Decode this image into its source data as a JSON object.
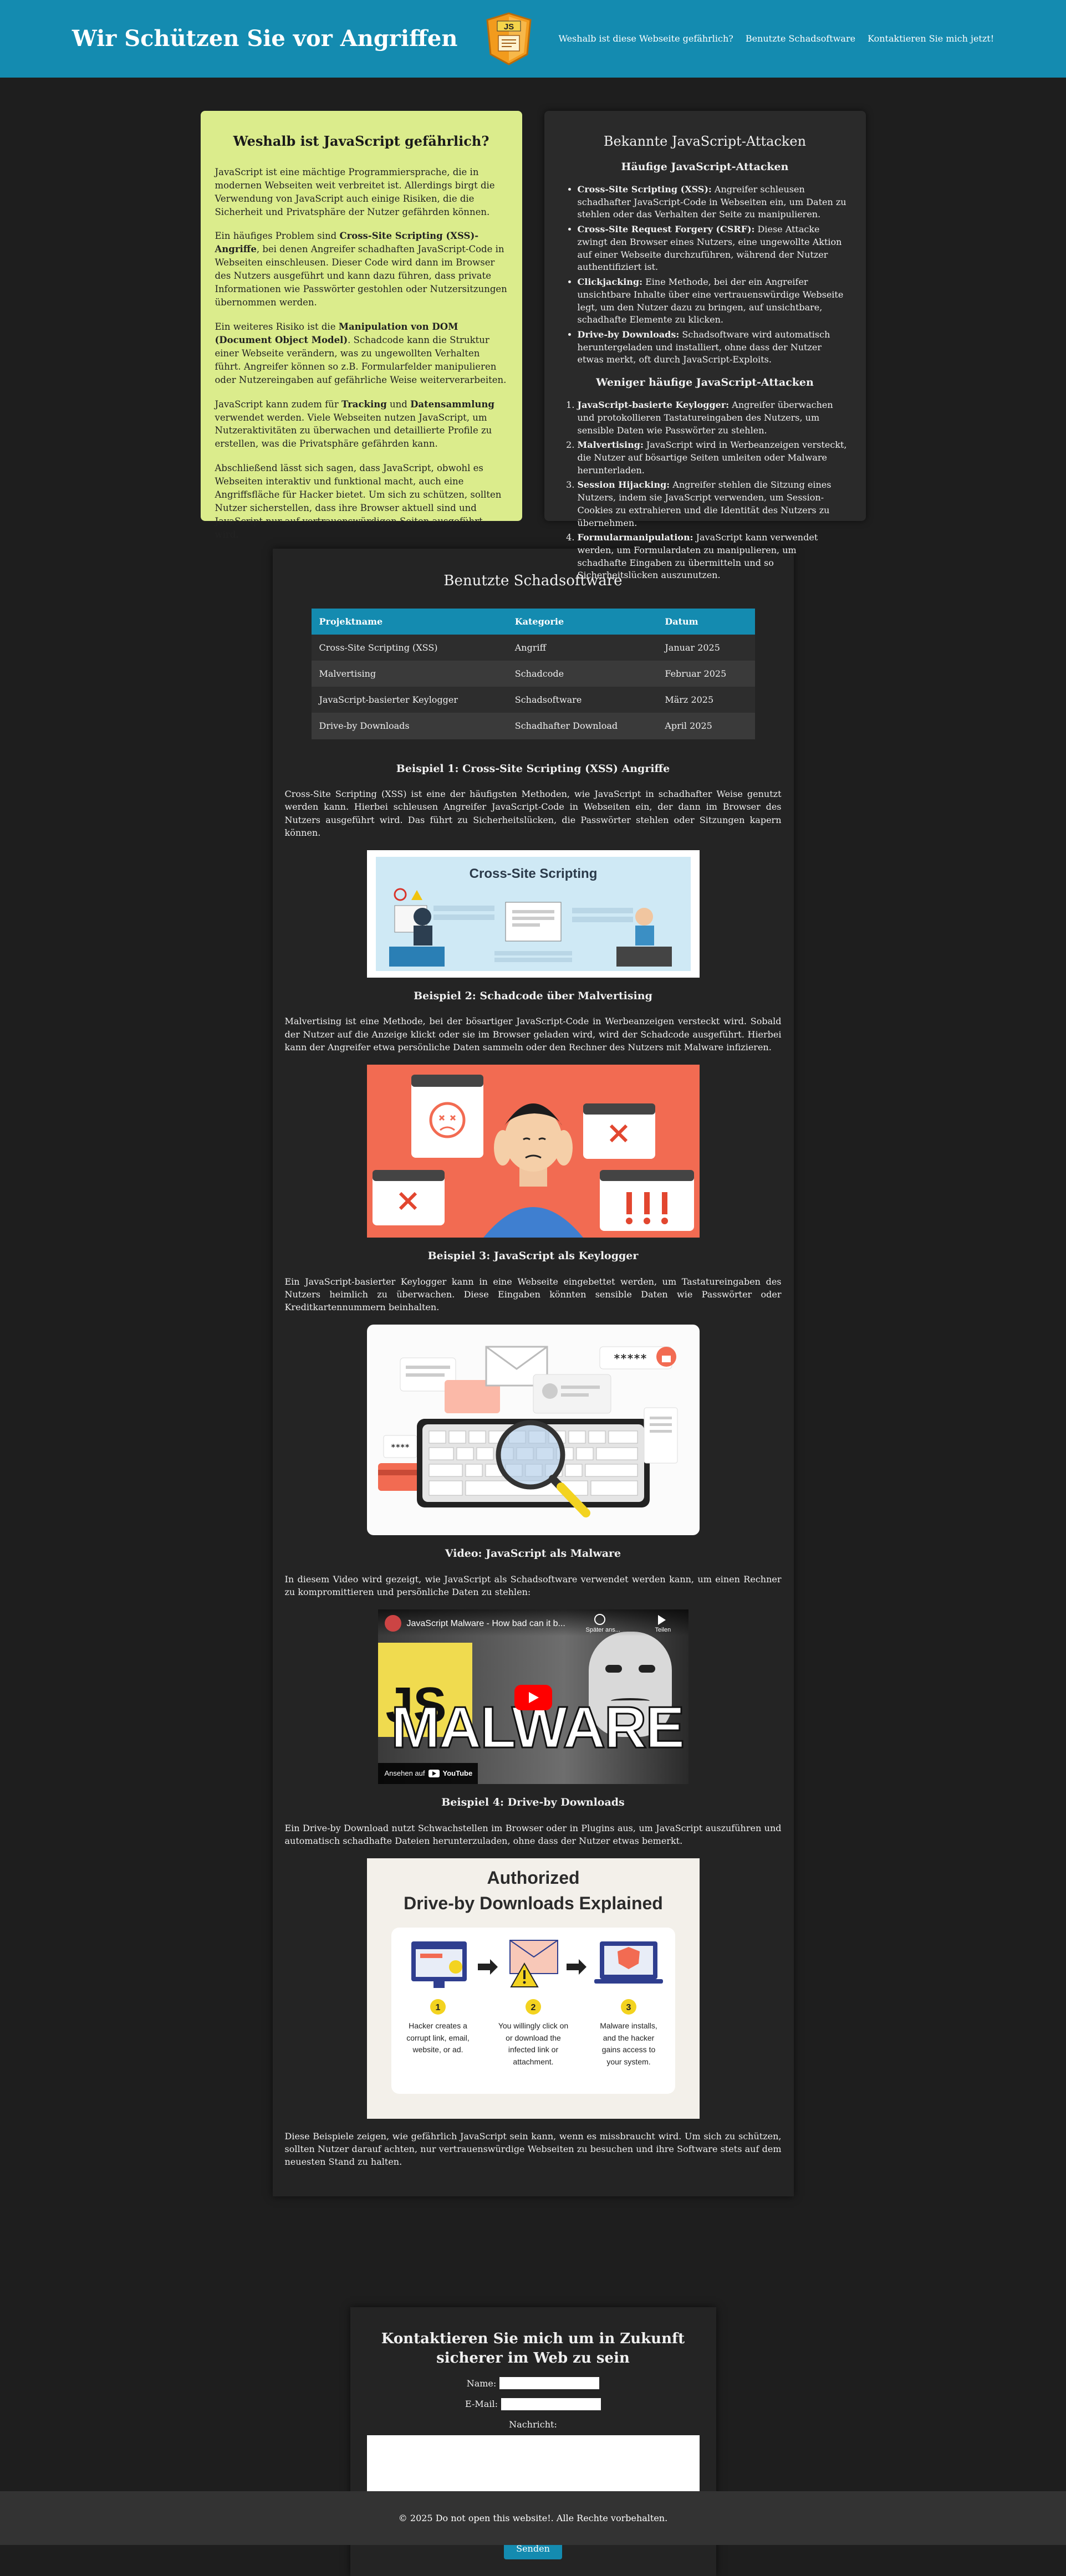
{
  "header": {
    "title": "Wir Schützen Sie vor Angriffen",
    "logo_text": "JS",
    "nav": [
      "Weshalb ist diese Webseite gefährlich?",
      "Benutzte Schadsoftware",
      "Kontaktieren Sie mich jetzt!"
    ]
  },
  "why": {
    "heading": "Weshalb ist JavaScript gefährlich?",
    "p1": "JavaScript ist eine mächtige Programmiersprache, die in modernen Webseiten weit verbreitet ist. Allerdings birgt die Verwendung von JavaScript auch einige Risiken, die die Sicherheit und Privatsphäre der Nutzer gefährden können.",
    "p2_a": "Ein häufiges Problem sind ",
    "p2_b": "Cross-Site Scripting (XSS)-Angriffe",
    "p2_c": ", bei denen Angreifer schadhaften JavaScript-Code in Webseiten einschleusen. Dieser Code wird dann im Browser des Nutzers ausgeführt und kann dazu führen, dass private Informationen wie Passwörter gestohlen oder Nutzersitzungen übernommen werden.",
    "p3_a": "Ein weiteres Risiko ist die ",
    "p3_b": "Manipulation von DOM (Document Object Model)",
    "p3_c": ". Schadcode kann die Struktur einer Webseite verändern, was zu ungewollten Verhalten führt. Angreifer können so z.B. Formularfelder manipulieren oder Nutzereingaben auf gefährliche Weise weiterverarbeiten.",
    "p4_a": "JavaScript kann zudem für ",
    "p4_b": "Tracking",
    "p4_c": " und ",
    "p4_d": "Datensammlung",
    "p4_e": " verwendet werden. Viele Webseiten nutzen JavaScript, um Nutzeraktivitäten zu überwachen und detaillierte Profile zu erstellen, was die Privatsphäre gefährden kann.",
    "p5": "Abschließend lässt sich sagen, dass JavaScript, obwohl es Webseiten interaktiv und funktional macht, auch eine Angriffsfläche für Hacker bietet. Um sich zu schützen, sollten Nutzer sicherstellen, dass ihre Browser aktuell sind und JavaScript nur auf vertrauenswürdigen Seiten ausgeführt wird."
  },
  "attacks": {
    "heading": "Bekannte JavaScript-Attacken",
    "common_heading": "Häufige JavaScript-Attacken",
    "common": [
      {
        "term": "Cross-Site Scripting (XSS):",
        "text": " Angreifer schleusen schadhafter JavaScript-Code in Webseiten ein, um Daten zu stehlen oder das Verhalten der Seite zu manipulieren."
      },
      {
        "term": "Cross-Site Request Forgery (CSRF):",
        "text": " Diese Attacke zwingt den Browser eines Nutzers, eine ungewollte Aktion auf einer Webseite durchzuführen, während der Nutzer authentifiziert ist."
      },
      {
        "term": "Clickjacking:",
        "text": " Eine Methode, bei der ein Angreifer unsichtbare Inhalte über eine vertrauenswürdige Webseite legt, um den Nutzer dazu zu bringen, auf unsichtbare, schadhafte Elemente zu klicken."
      },
      {
        "term": "Drive-by Downloads:",
        "text": " Schadsoftware wird automatisch heruntergeladen und installiert, ohne dass der Nutzer etwas merkt, oft durch JavaScript-Exploits."
      }
    ],
    "rare_heading": "Weniger häufige JavaScript-Attacken",
    "rare": [
      {
        "term": "JavaScript-basierte Keylogger:",
        "text": " Angreifer überwachen und protokollieren Tastatureingaben des Nutzers, um sensible Daten wie Passwörter zu stehlen."
      },
      {
        "term": "Malvertising:",
        "text": " JavaScript wird in Werbeanzeigen versteckt, die Nutzer auf bösartige Seiten umleiten oder Malware herunterladen."
      },
      {
        "term": "Session Hijacking:",
        "text": " Angreifer stehlen die Sitzung eines Nutzers, indem sie JavaScript verwenden, um Session-Cookies zu extrahieren und die Identität des Nutzers zu übernehmen."
      },
      {
        "term": "Formularmanipulation:",
        "text": " JavaScript kann verwendet werden, um Formulardaten zu manipulieren, um schadhafte Eingaben zu übermitteln und so Sicherheitslücken auszunutzen."
      }
    ]
  },
  "malware": {
    "heading": "Benutzte Schadsoftware",
    "columns": [
      "Projektname",
      "Kategorie",
      "Datum"
    ],
    "rows": [
      [
        "Cross-Site Scripting (XSS)",
        "Angriff",
        "Januar 2025"
      ],
      [
        "Malvertising",
        "Schadcode",
        "Februar 2025"
      ],
      [
        "JavaScript-basierter Keylogger",
        "Schadsoftware",
        "März 2025"
      ],
      [
        "Drive-by Downloads",
        "Schadhafter Download",
        "April 2025"
      ]
    ],
    "ex1_heading": "Beispiel 1: Cross-Site Scripting (XSS) Angriffe",
    "ex1_text": "Cross-Site Scripting (XSS) ist eine der häufigsten Methoden, wie JavaScript in schadhafter Weise genutzt werden kann. Hierbei schleusen Angreifer JavaScript-Code in Webseiten ein, der dann im Browser des Nutzers ausgeführt wird. Das führt zu Sicherheitslücken, die Passwörter stehlen oder Sitzungen kapern können.",
    "ex1_img_title": "Cross-Site Scripting",
    "ex2_heading": "Beispiel 2: Schadcode über Malvertising",
    "ex2_text": "Malvertising ist eine Methode, bei der bösartiger JavaScript-Code in Werbeanzeigen versteckt wird. Sobald der Nutzer auf die Anzeige klickt oder sie im Browser geladen wird, wird der Schadcode ausgeführt. Hierbei kann der Angreifer etwa persönliche Daten sammeln oder den Rechner des Nutzers mit Malware infizieren.",
    "ex3_heading": "Beispiel 3: JavaScript als Keylogger",
    "ex3_text": "Ein JavaScript-basierter Keylogger kann in eine Webseite eingebettet werden, um Tastatureingaben des Nutzers heimlich zu überwachen. Diese Eingaben könnten sensible Daten wie Passwörter oder Kreditkartennummern beinhalten.",
    "ex3_stars": "*****",
    "ex3_stars2": "****",
    "video_heading": "Video: JavaScript als Malware",
    "video_text": "In diesem Video wird gezeigt, wie JavaScript als Schadsoftware verwendet werden kann, um einen Rechner zu kompromittieren und persönliche Daten zu stehlen:",
    "video_title": "JavaScript Malware - How bad can it b...",
    "video_later": "Später ans...",
    "video_share": "Teilen",
    "video_js": "JS",
    "video_big": "MALWARE",
    "video_watch": "Ansehen auf",
    "video_yt": "YouTube",
    "ex4_heading": "Beispiel 4: Drive-by Downloads",
    "ex4_text": "Ein Drive-by Download nutzt Schwachstellen im Browser oder in Plugins aus, um JavaScript auszuführen und automatisch schadhafte Dateien herunterzuladen, ohne dass der Nutzer etwas bemerkt.",
    "ex4_img_title1": "Authorized",
    "ex4_img_title2": "Drive-by Downloads Explained",
    "ex4_steps": [
      {
        "num": "1",
        "text": "Hacker creates a corrupt link, email, website, or ad."
      },
      {
        "num": "2",
        "text": "You willingly click on or download the infected link or attachment."
      },
      {
        "num": "3",
        "text": "Malware installs, and the hacker gains access to your system."
      }
    ],
    "closing": "Diese Beispiele zeigen, wie gefährlich JavaScript sein kann, wenn es missbraucht wird. Um sich zu schützen, sollten Nutzer darauf achten, nur vertrauenswürdige Webseiten zu besuchen und ihre Software stets auf dem neuesten Stand zu halten."
  },
  "contact": {
    "heading": "Kontaktieren Sie mich um in Zukunft sicherer im Web zu sein",
    "name_label": "Name:",
    "email_label": "E-Mail:",
    "message_label": "Nachricht:",
    "submit": "Senden"
  },
  "footer": {
    "text": "© 2025 Do not open this website!. Alle Rechte vorbehalten."
  }
}
